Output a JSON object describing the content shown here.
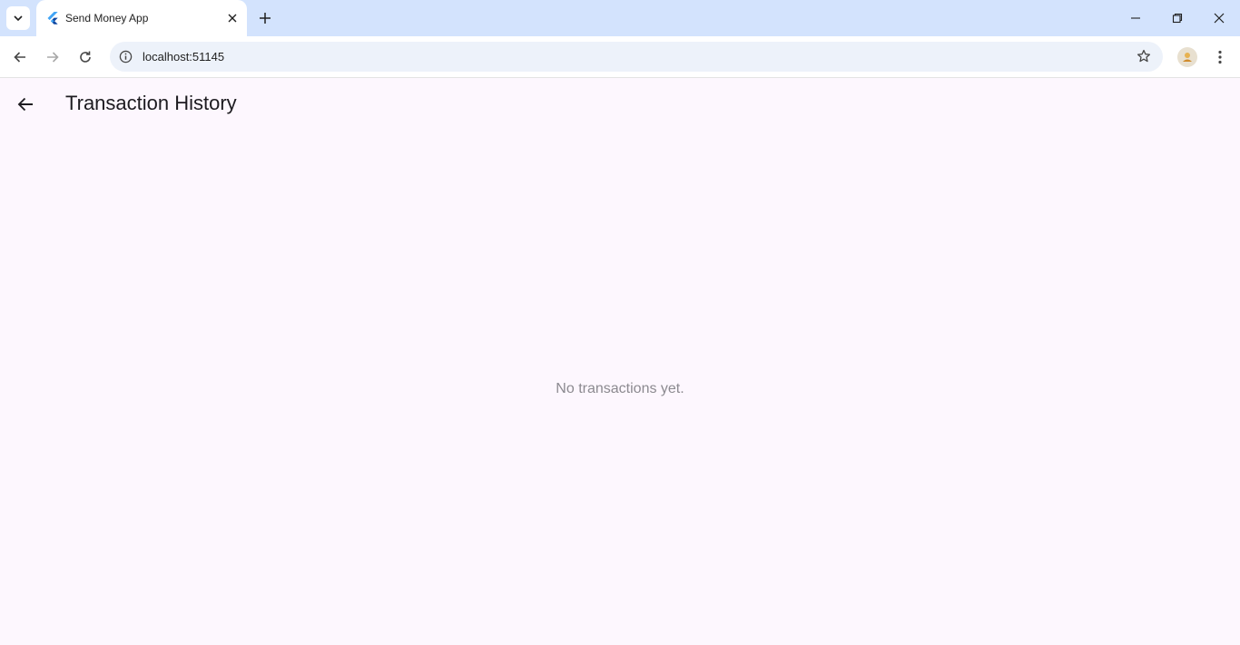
{
  "browser": {
    "tab": {
      "title": "Send Money App",
      "favicon": "flutter-icon"
    },
    "url": "localhost:51145",
    "icons": {
      "tab_search": "chevron-down-icon",
      "tab_close": "close-icon",
      "new_tab": "plus-icon",
      "minimize": "minimize-icon",
      "restore": "restore-icon",
      "close": "close-icon",
      "back": "arrow-left-icon",
      "forward": "arrow-right-icon",
      "reload": "reload-icon",
      "site_info": "info-icon",
      "bookmark": "star-icon",
      "profile": "avatar",
      "menu": "more-vert-icon"
    },
    "colors": {
      "tabstrip": "#d3e3fd",
      "omnibox": "#edf2fa"
    }
  },
  "app": {
    "title": "Transaction History",
    "empty_message": "No transactions yet.",
    "icons": {
      "back": "arrow-left-icon"
    },
    "colors": {
      "background": "#fdf7fe",
      "muted_text": "#8c8a90"
    }
  }
}
